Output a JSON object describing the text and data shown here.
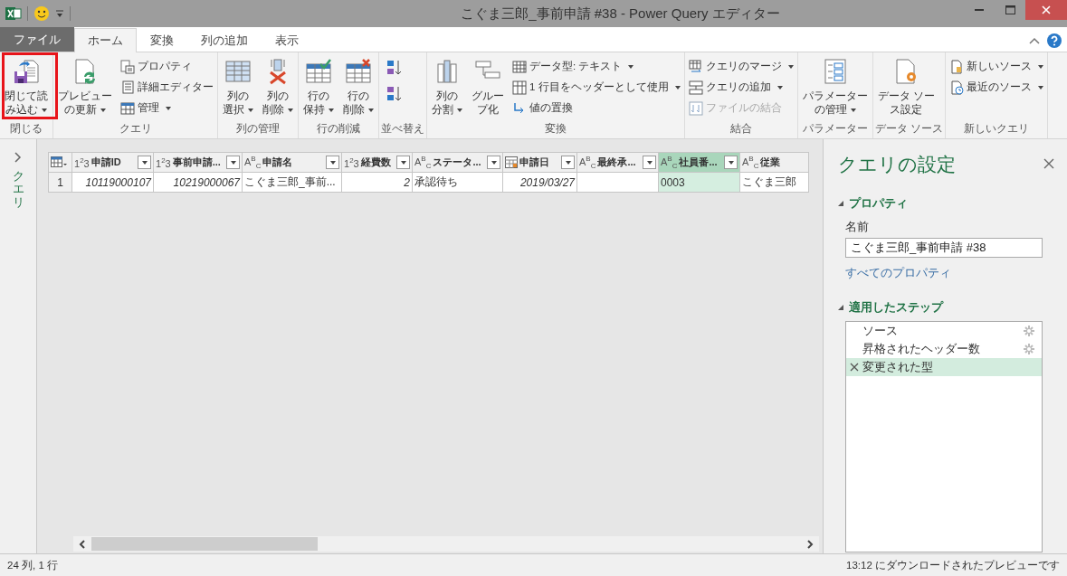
{
  "window": {
    "title": "こぐま三郎_事前申請 #38 - Power Query エディター"
  },
  "tabs": [
    {
      "label": "ファイル",
      "kind": "file",
      "selected": false
    },
    {
      "label": "ホーム",
      "kind": "tab",
      "selected": true
    },
    {
      "label": "変換",
      "kind": "tab",
      "selected": false
    },
    {
      "label": "列の追加",
      "kind": "tab",
      "selected": false
    },
    {
      "label": "表示",
      "kind": "tab",
      "selected": false
    }
  ],
  "ribbon": [
    {
      "label": "閉じる",
      "items": [
        {
          "kind": "large",
          "lines": [
            "閉じて読",
            "み込む"
          ],
          "dropdown": true,
          "highlighted": true
        }
      ]
    },
    {
      "label": "クエリ",
      "items": [
        {
          "kind": "large",
          "lines": [
            "プレビュー",
            "の更新"
          ],
          "dropdown": true,
          "highlighted": false
        },
        {
          "kind": "stack",
          "items": [
            {
              "label": "プロパティ",
              "dropdown": false,
              "disabled": false
            },
            {
              "label": "詳細エディター",
              "dropdown": false,
              "disabled": false
            },
            {
              "label": "管理",
              "dropdown": true,
              "disabled": false
            }
          ]
        }
      ]
    },
    {
      "label": "列の管理",
      "items": [
        {
          "kind": "large",
          "lines": [
            "列の",
            "選択"
          ],
          "dropdown": true,
          "highlighted": false
        },
        {
          "kind": "large",
          "lines": [
            "列の",
            "削除"
          ],
          "dropdown": true,
          "highlighted": false
        }
      ]
    },
    {
      "label": "行の削減",
      "items": [
        {
          "kind": "large",
          "lines": [
            "行の",
            "保持"
          ],
          "dropdown": true,
          "highlighted": false
        },
        {
          "kind": "large",
          "lines": [
            "行の",
            "削除"
          ],
          "dropdown": true,
          "highlighted": false
        }
      ]
    },
    {
      "label": "並べ替え",
      "items": [
        {
          "kind": "sort"
        }
      ]
    },
    {
      "label": "変換",
      "items": [
        {
          "kind": "large",
          "lines": [
            "列の",
            "分割"
          ],
          "dropdown": true,
          "highlighted": false
        },
        {
          "kind": "large",
          "lines": [
            "グルー",
            "プ化"
          ],
          "dropdown": false,
          "highlighted": false
        },
        {
          "kind": "stack",
          "items": [
            {
              "label": "データ型: テキスト",
              "dropdown": true,
              "disabled": false
            },
            {
              "label": "1 行目をヘッダーとして使用",
              "dropdown": true,
              "disabled": false
            },
            {
              "label": "値の置換",
              "dropdown": false,
              "disabled": false
            }
          ]
        }
      ]
    },
    {
      "label": "結合",
      "items": [
        {
          "kind": "stack",
          "items": [
            {
              "label": "クエリのマージ",
              "dropdown": true,
              "disabled": false
            },
            {
              "label": "クエリの追加",
              "dropdown": true,
              "disabled": false
            },
            {
              "label": "ファイルの結合",
              "dropdown": false,
              "disabled": true
            }
          ]
        }
      ]
    },
    {
      "label": "パラメーター",
      "items": [
        {
          "kind": "large",
          "lines": [
            "パラメーター",
            "の管理"
          ],
          "dropdown": true,
          "highlighted": false
        }
      ]
    },
    {
      "label": "データ ソース",
      "items": [
        {
          "kind": "large",
          "lines": [
            "データ ソー",
            "ス設定"
          ],
          "dropdown": false,
          "highlighted": false
        }
      ]
    },
    {
      "label": "新しいクエリ",
      "items": [
        {
          "kind": "stack",
          "items": [
            {
              "label": "新しいソース",
              "dropdown": true,
              "disabled": false
            },
            {
              "label": "最近のソース",
              "dropdown": true,
              "disabled": false
            }
          ]
        }
      ]
    }
  ],
  "query_pane": {
    "label": "クエリ"
  },
  "table": {
    "columns": [
      {
        "kind": "number",
        "type_label": "1$^{2}$3",
        "name": "申請ID",
        "selected": false
      },
      {
        "kind": "number",
        "type_label": "1$^{2}$3",
        "name": "事前申請...",
        "selected": false
      },
      {
        "kind": "text",
        "type_label": "A$^{B}$$_{C}$",
        "name": "申請名",
        "selected": false
      },
      {
        "kind": "number",
        "type_label": "1$^{2}$3",
        "name": "経費数",
        "selected": false
      },
      {
        "kind": "text",
        "type_label": "A$^{B}$$_{C}$",
        "name": "ステータ...",
        "selected": false
      },
      {
        "kind": "date",
        "name": "申請日",
        "selected": false
      },
      {
        "kind": "text",
        "type_label": "A$^{B}$$_{C}$",
        "name": "最終承...",
        "selected": false
      },
      {
        "kind": "text",
        "type_label": "A$^{B}$$_{C}$",
        "name": "社員番...",
        "selected": true
      },
      {
        "kind": "text",
        "type_label": "A$^{B}$$_{C}$",
        "name": "従業",
        "selected": false
      }
    ],
    "rows": [
      {
        "number": "1",
        "cells": [
          "10119000107",
          "10219000067",
          "こぐま三郎_事前...",
          "2",
          "承認待ち",
          "2019/03/27",
          "",
          "0003",
          "こぐま三郎"
        ]
      }
    ]
  },
  "settings": {
    "title": "クエリの設定",
    "properties_heading": "プロパティ",
    "name_label": "名前",
    "name_value": "こぐま三郎_事前申請 #38",
    "all_properties_link": "すべてのプロパティ",
    "steps_heading": "適用したステップ",
    "steps": [
      {
        "label": "ソース",
        "has_settings": true,
        "selected": false
      },
      {
        "label": "昇格されたヘッダー数",
        "has_settings": true,
        "selected": false
      },
      {
        "label": "変更された型",
        "has_settings": false,
        "selected": true
      }
    ]
  },
  "status_bar": {
    "left": "24 列, 1 行",
    "right": "13:12 にダウンロードされたプレビューです"
  }
}
